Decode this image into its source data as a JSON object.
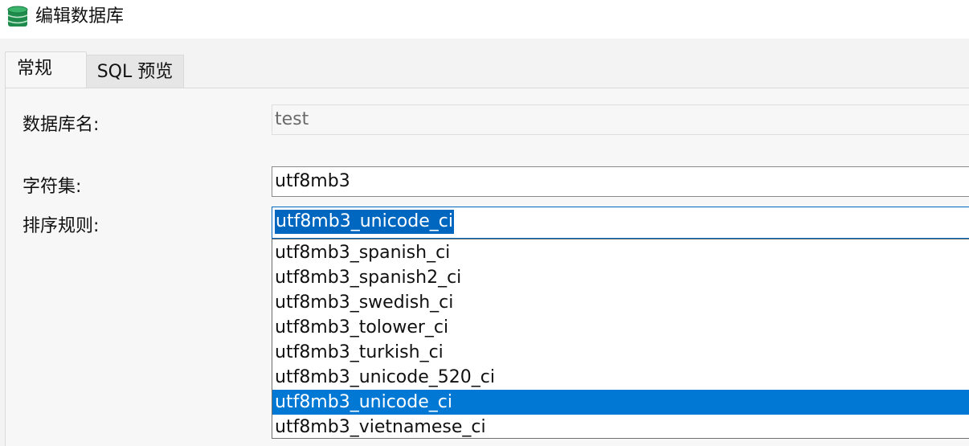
{
  "window": {
    "title": "编辑数据库",
    "icon": "database-icon"
  },
  "tabs": [
    {
      "label": "常规",
      "active": true
    },
    {
      "label": "SQL 预览",
      "active": false
    }
  ],
  "form": {
    "dbname_label": "数据库名:",
    "dbname_value": "test",
    "charset_label": "字符集:",
    "charset_value": "utf8mb3",
    "collation_label": "排序规则:",
    "collation_value": "utf8mb3_unicode_ci"
  },
  "collation_options": [
    "utf8mb3_spanish_ci",
    "utf8mb3_spanish2_ci",
    "utf8mb3_swedish_ci",
    "utf8mb3_tolower_ci",
    "utf8mb3_turkish_ci",
    "utf8mb3_unicode_520_ci",
    "utf8mb3_unicode_ci",
    "utf8mb3_vietnamese_ci"
  ],
  "selected_option": "utf8mb3_unicode_ci",
  "colors": {
    "accent": "#0078d4",
    "selection": "#0067c0",
    "icon_green": "#1e8a4c"
  }
}
